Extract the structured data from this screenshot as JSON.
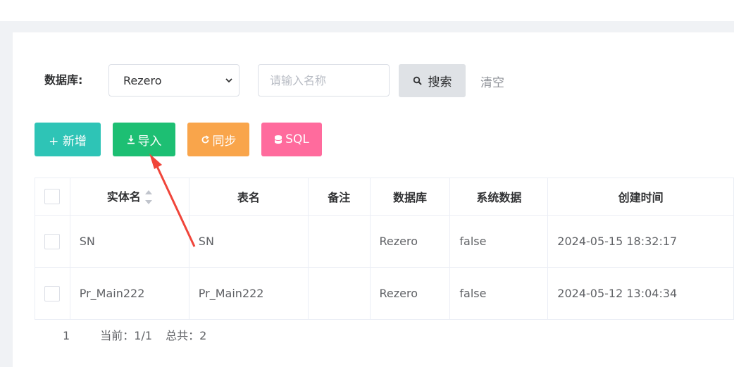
{
  "filter": {
    "db_label": "数据库:",
    "db_selected": "Rezero",
    "name_placeholder": "请输入名称",
    "search_label": "搜索",
    "clear_label": "清空"
  },
  "toolbar": {
    "add_label": "+ 新增",
    "import_label": "导入",
    "sync_label": "同步",
    "sql_label": "SQL"
  },
  "table": {
    "headers": [
      "实体名",
      "表名",
      "备注",
      "数据库",
      "系统数据",
      "创建时间"
    ],
    "rows": [
      {
        "entity": "SN",
        "table": "SN",
        "remark": "",
        "db": "Rezero",
        "system": "false",
        "created": "2024-05-15 18:32:17"
      },
      {
        "entity": "Pr_Main222",
        "table": "Pr_Main222",
        "remark": "",
        "db": "Rezero",
        "system": "false",
        "created": "2024-05-12 13:04:34"
      }
    ]
  },
  "pagination": {
    "page": "1",
    "current": "当前：1/1",
    "total": "总共：2"
  },
  "colors": {
    "add": "#2ec4b6",
    "import": "#1dbf73",
    "sync": "#f9a54b",
    "sql": "#ff6b9d",
    "annotation_arrow": "#f0453a"
  },
  "icons": {
    "search": "search-icon",
    "import": "download-icon",
    "sync": "refresh-icon",
    "sql": "database-icon"
  }
}
